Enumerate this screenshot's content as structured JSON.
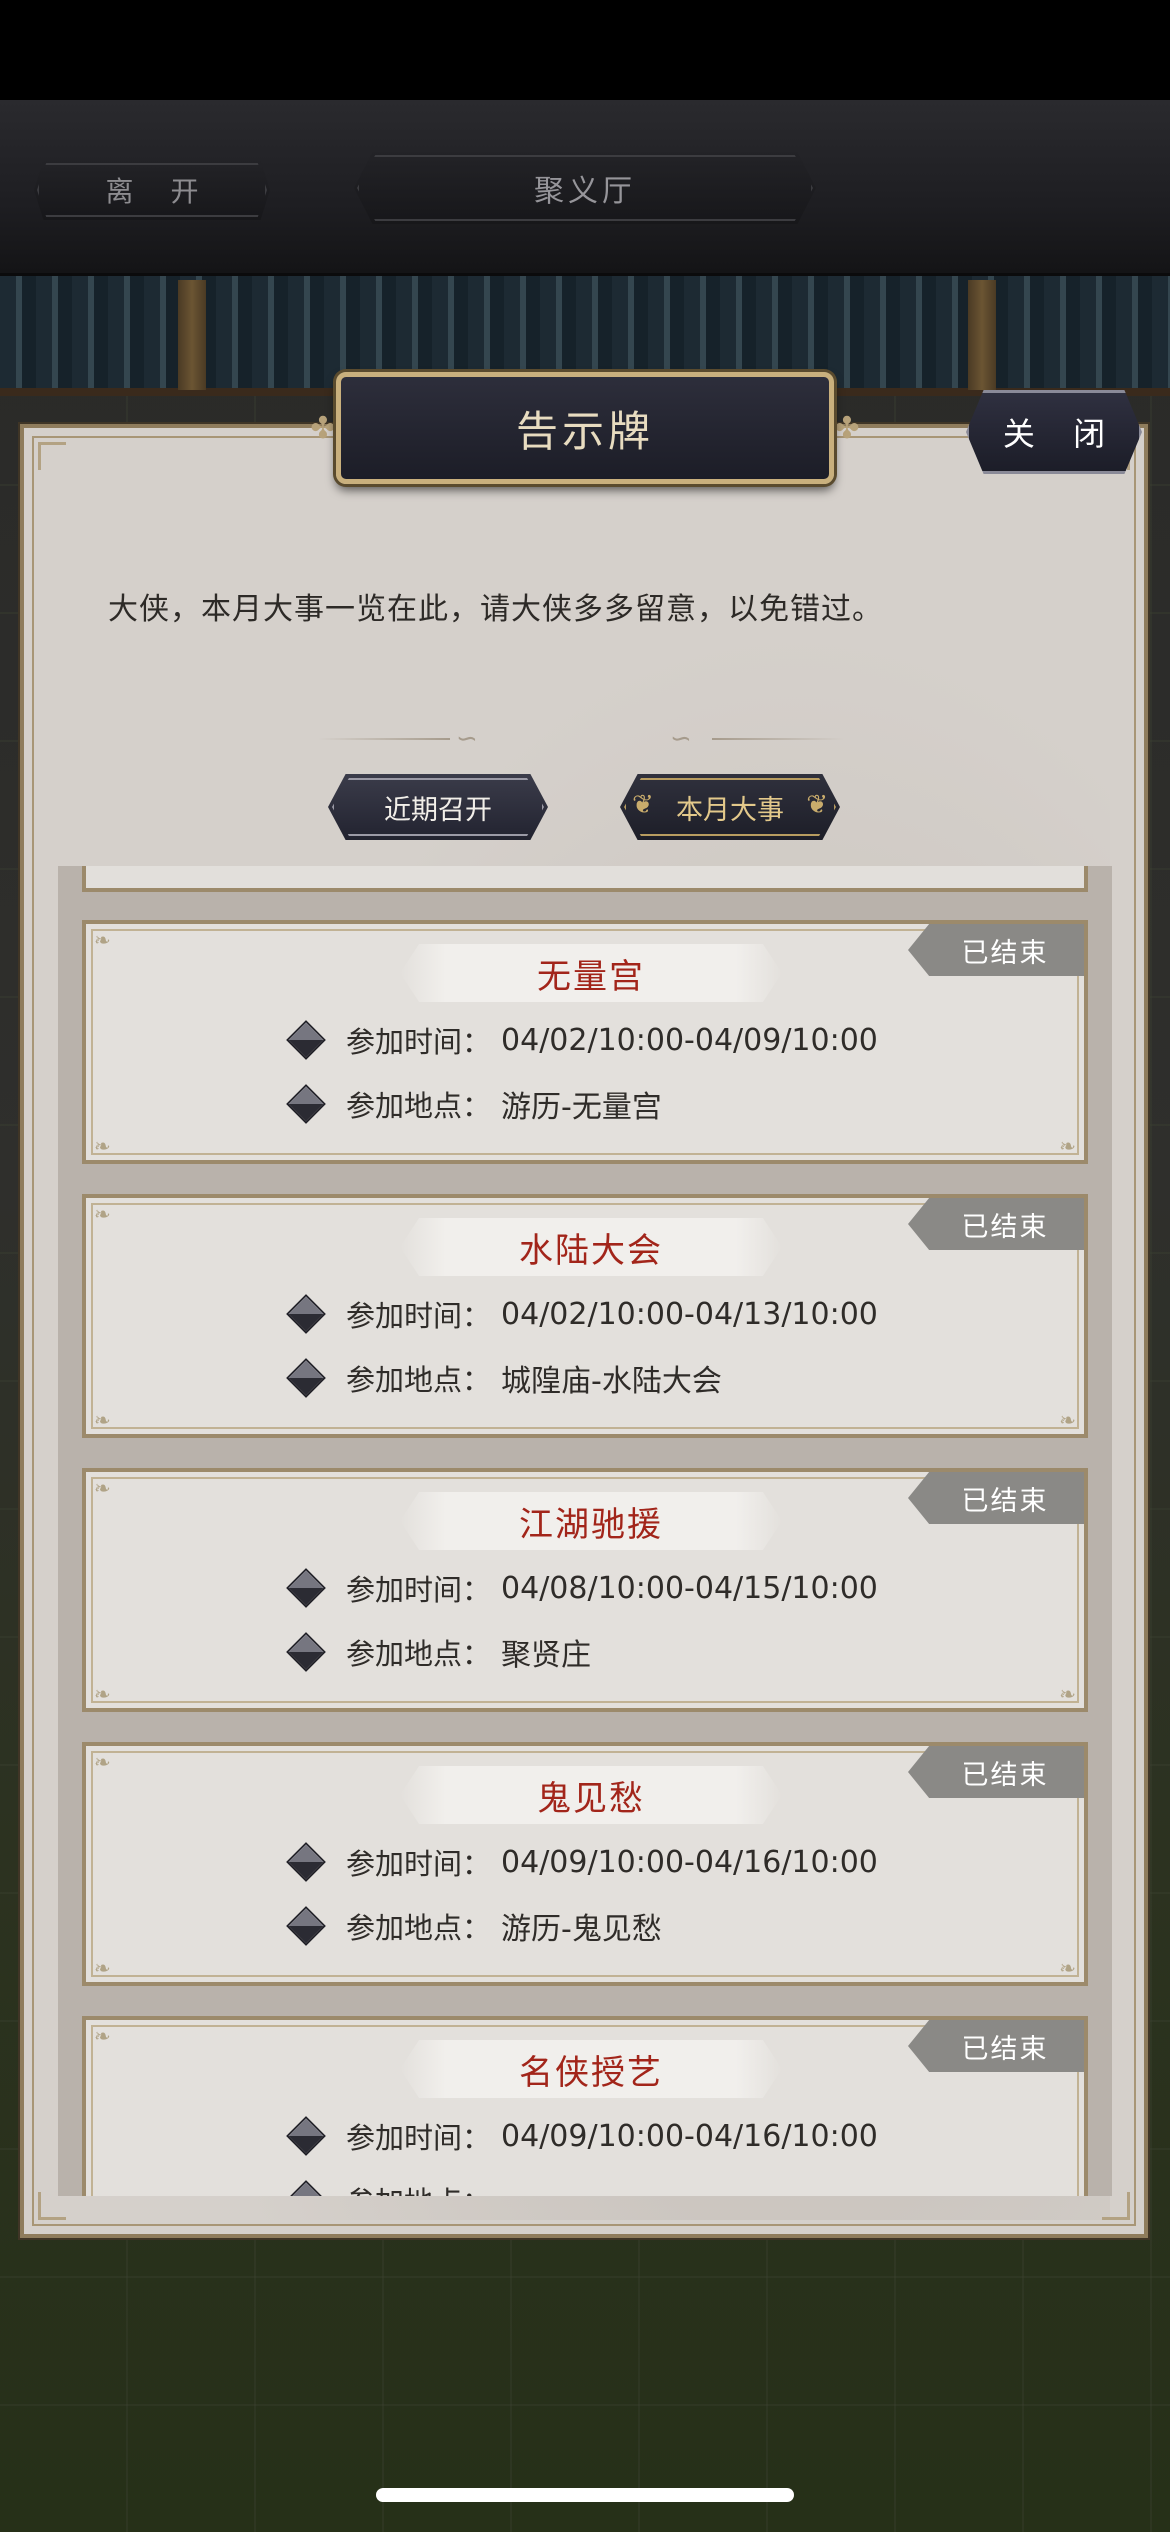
{
  "nav": {
    "leave_label": "离 开",
    "hall_title": "聚义厅"
  },
  "notice": {
    "title": "告示牌",
    "close_label": "关 闭",
    "intro": "大侠，本月大事一览在此，请大侠多多留意，以免错过。",
    "tabs": [
      {
        "label": "近期召开",
        "selected": false
      },
      {
        "label": "本月大事",
        "selected": true
      }
    ]
  },
  "events": [
    {
      "name": "无量宫",
      "status": "已结束",
      "time_label": "参加时间：",
      "time": "04/02/10:00-04/09/10:00",
      "place_label": "参加地点：",
      "place": "游历-无量宫"
    },
    {
      "name": "水陆大会",
      "status": "已结束",
      "time_label": "参加时间：",
      "time": "04/02/10:00-04/13/10:00",
      "place_label": "参加地点：",
      "place": "城隍庙-水陆大会"
    },
    {
      "name": "江湖驰援",
      "status": "已结束",
      "time_label": "参加时间：",
      "time": "04/08/10:00-04/15/10:00",
      "place_label": "参加地点：",
      "place": "聚贤庄"
    },
    {
      "name": "鬼见愁",
      "status": "已结束",
      "time_label": "参加时间：",
      "time": "04/09/10:00-04/16/10:00",
      "place_label": "参加地点：",
      "place": "游历-鬼见愁"
    },
    {
      "name": "名侠授艺",
      "status": "已结束",
      "time_label": "参加时间：",
      "time": "04/09/10:00-04/16/10:00",
      "place_label": "参加地点：",
      "place": ""
    }
  ],
  "colors": {
    "title_red": "#a2251a",
    "badge_gray": "#8a8986",
    "panel_bg": "#d5d0cb",
    "gold_border": "#c9b07d"
  },
  "icons": {
    "bullet": "diamond-icon",
    "ornament": "cloud-scroll-icon"
  }
}
